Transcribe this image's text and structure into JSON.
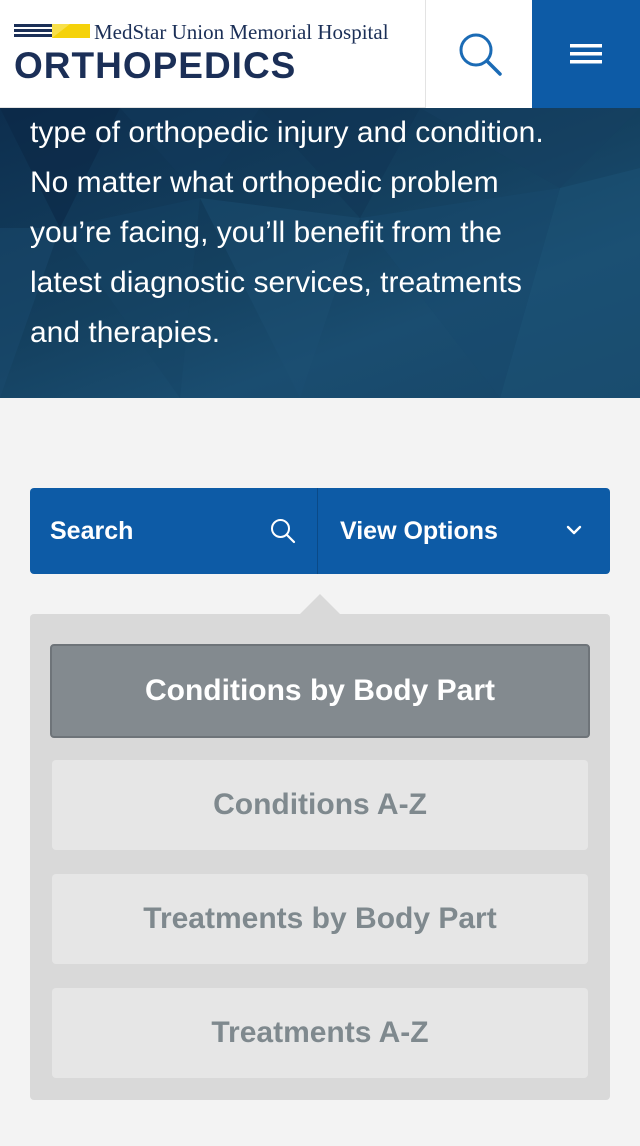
{
  "header": {
    "logo_sub": "MedStar Union Memorial Hospital",
    "logo_main": "ORTHOPEDICS",
    "search_icon": "search-icon",
    "menu_icon": "hamburger-menu-icon"
  },
  "hero": {
    "lines": [
      "type of orthopedic injury and condition.",
      "No matter what orthopedic problem",
      "you’re facing, you’ll benefit from the",
      "latest diagnostic services, treatments",
      "and therapies."
    ]
  },
  "toolbar": {
    "search_label": "Search",
    "view_label": "View Options",
    "search_icon": "search-icon",
    "dropdown_icon": "chevron-down-icon"
  },
  "options": [
    {
      "label": "Conditions by Body Part",
      "active": true
    },
    {
      "label": "Conditions A-Z",
      "active": false
    },
    {
      "label": "Treatments by Body Part",
      "active": false
    },
    {
      "label": "Treatments A-Z",
      "active": false
    }
  ],
  "colors": {
    "brand_navy": "#1b2f57",
    "brand_blue": "#0d5ba6",
    "brand_yellow": "#f5d20a",
    "active_option": "#838a8f",
    "inactive_option": "#e6e6e6"
  }
}
